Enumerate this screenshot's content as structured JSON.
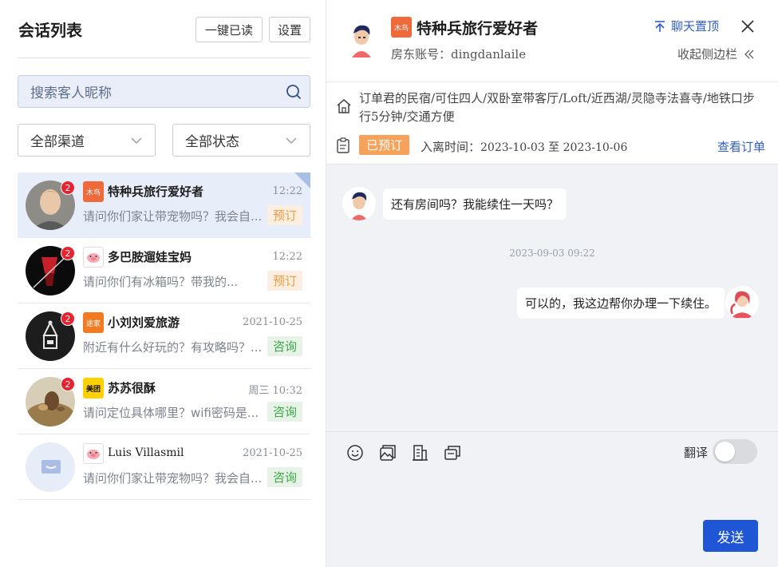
{
  "left": {
    "title": "会话列表",
    "read_all_label": "一键已读",
    "settings_label": "设置",
    "search_placeholder": "搜索客人昵称",
    "channel_filter": "全部渠道",
    "status_filter": "全部状态",
    "conversations": [
      {
        "name": "特种兵旅行爱好者",
        "time": "12:22",
        "preview": "请问你们家让带宠物吗？我会自...",
        "tag": "预订",
        "badge": "2",
        "platform": "木鸟",
        "platform_color": "#f0693a",
        "selected": true
      },
      {
        "name": "多巴胺遛娃宝妈",
        "time": "12:22",
        "preview": "请问你们有冰箱吗？带我的...",
        "tag": "预订",
        "badge": "2",
        "platform": "pig-icon",
        "platform_color": "#f9c9cf",
        "selected": false
      },
      {
        "name": "小刘刘爱旅游",
        "time": "2021-10-25",
        "preview": "附近有什么好玩的？有攻略吗？...",
        "tag": "咨询",
        "badge": "2",
        "platform": "途家",
        "platform_color": "#f27a20",
        "selected": false
      },
      {
        "name": "苏苏很酥",
        "time": "周三 10:32",
        "preview": "请问定位具体哪里？wifi密码是...",
        "tag": "咨询",
        "badge": "2",
        "platform": "美团",
        "platform_color": "#ffd100",
        "selected": false
      },
      {
        "name": "Luis Villasmil",
        "time": "2021-10-25",
        "preview": "请问你们家让带宠物吗？我会自...",
        "tag": "咨询",
        "badge": "",
        "platform": "pig-icon",
        "platform_color": "#f9c9cf",
        "selected": false
      }
    ]
  },
  "right": {
    "header": {
      "platform": "木鸟",
      "name": "特种兵旅行爱好者",
      "account": "房东账号：dingdanlaile",
      "pin_label": "聊天置顶",
      "collapse_label": "收起侧边栏"
    },
    "order": {
      "title": "订单君的民宿/可住四人/双卧室带客厅/Loft/近西湖/灵隐寺法喜寺/地铁口步行5分钟/交通方便",
      "status": "已预订",
      "checkin_label": "入离时间：",
      "checkin_value": "2023-10-03 至 2023-10-06",
      "view_label": "查看订单"
    },
    "messages": {
      "guest_text": "还有房间吗？我能续住一天吗？",
      "timestamp": "2023-09-03 09:22",
      "host_text": "可以的，我这边帮你办理一下续住。"
    },
    "compose": {
      "translate_label": "翻译",
      "translate_on": false,
      "send_label": "发送"
    }
  },
  "colors": {
    "accent": "#1e56d6",
    "link": "#2f5fc9",
    "booked_tag": "#f29a3f",
    "consult_tag": "#3ea84a",
    "badge": "#e8222f"
  }
}
